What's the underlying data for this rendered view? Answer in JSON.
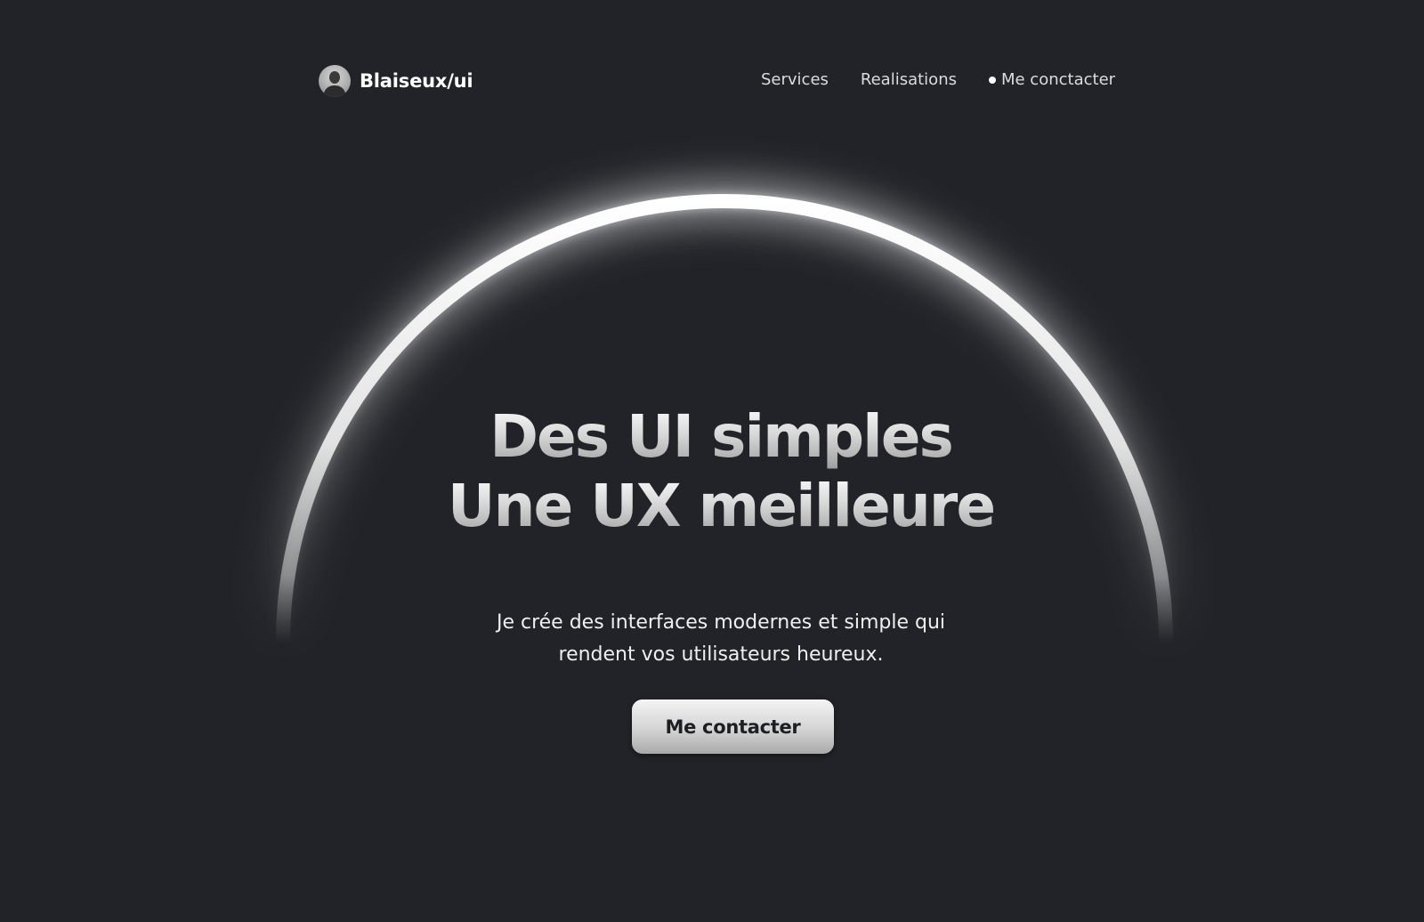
{
  "header": {
    "brand_name": "Blaiseux/ui",
    "nav": {
      "services": "Services",
      "realisations": "Realisations",
      "contact": "Me conctacter"
    }
  },
  "hero": {
    "headline_line1": "Des UI simples",
    "headline_line2": "Une UX meilleure",
    "subtitle_line1": "Je crée des interfaces modernes et simple qui",
    "subtitle_line2": "rendent vos utilisateurs heureux.",
    "cta_label": "Me contacter"
  },
  "colors": {
    "background": "#212328",
    "arc_glow": "#ffffff",
    "text": "#efefef",
    "button_text": "#1e1f23"
  }
}
